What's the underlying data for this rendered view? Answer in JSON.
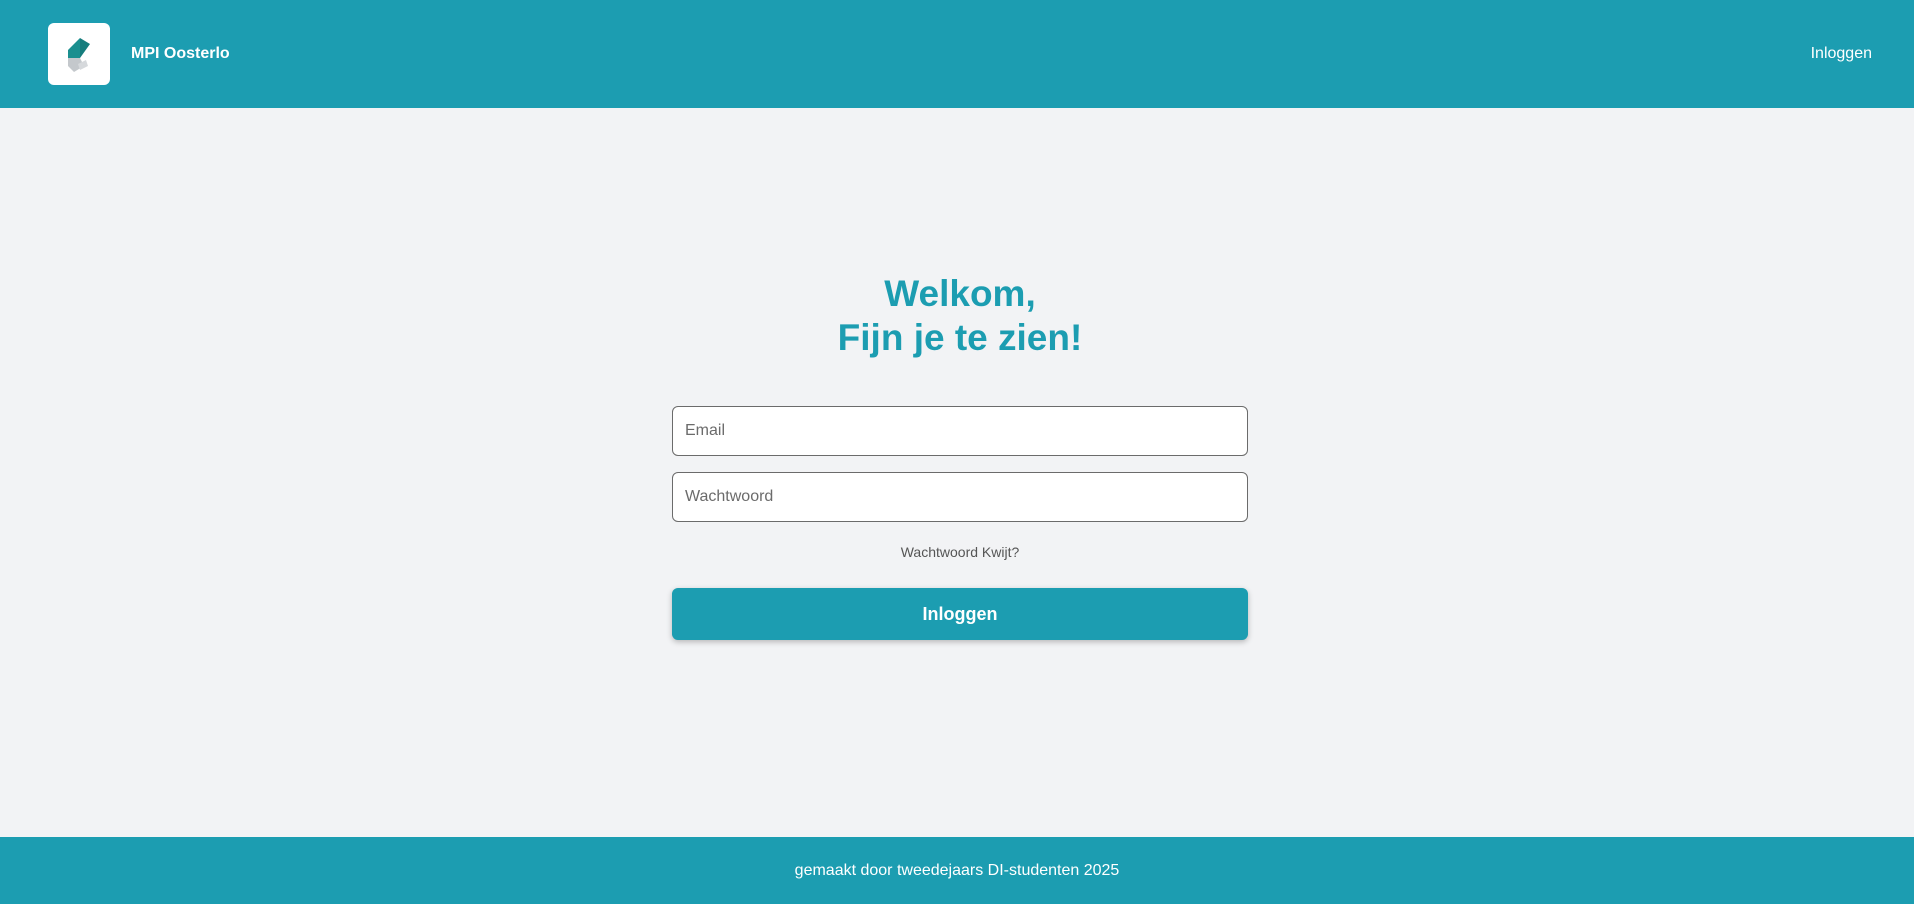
{
  "header": {
    "logo_icon": "school-logo-icon",
    "brand_name": "MPI Oosterlo",
    "nav_login_label": "Inloggen"
  },
  "login": {
    "welcome_line1": "Welkom,",
    "welcome_line2": "Fijn je te zien!",
    "email_placeholder": "Email",
    "email_value": "",
    "password_placeholder": "Wachtwoord",
    "password_value": "",
    "forgot_label": "Wachtwoord Kwijt?",
    "submit_label": "Inloggen"
  },
  "footer": {
    "text": "gemaakt door tweedejaars DI-studenten 2025"
  },
  "colors": {
    "accent": "#1c9db1",
    "background": "#f2f3f5",
    "logo_teal": "#1a8f8f",
    "logo_grey": "#c4c8cc"
  }
}
